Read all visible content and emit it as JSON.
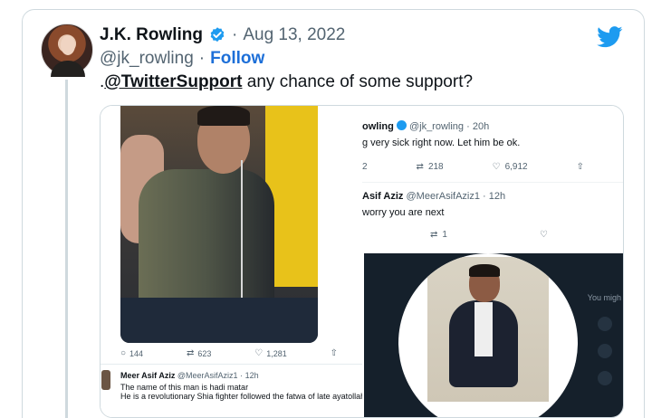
{
  "tweet": {
    "name": "J.K. Rowling",
    "date_separator": "·",
    "date": "Aug 13, 2022",
    "handle": "@jk_rowling",
    "handle_separator": "·",
    "follow_label": "Follow",
    "text_prefix": ".",
    "mention": "@TwitterSupport",
    "text_rest": " any chance of some support?"
  },
  "icons": {
    "verified": "verified-badge-icon",
    "brand": "twitter-bird-icon",
    "reply": "reply-icon",
    "retweet": "retweet-icon",
    "like": "like-icon",
    "share": "share-icon"
  },
  "colors": {
    "accent": "#1d9bf0",
    "follow": "#1d6fd8",
    "muted": "#536471",
    "dark_panel": "#15202b"
  },
  "left_shot": {
    "actions": {
      "replies": "144",
      "retweets": "623",
      "likes": "1,281"
    },
    "reply": {
      "name": "Meer Asif Aziz",
      "handle": "@MeerAsifAziz1",
      "sep": "·",
      "time": "12h",
      "line1": "The name of this man is hadi matar",
      "line2": "He is a revolutionary Shia fighter followed the fatwa of late ayatollah"
    }
  },
  "right_shot": {
    "header_name": "owling",
    "header_handle": "@jk_rowling",
    "header_sep": "·",
    "header_time": "20h",
    "header_text": "g very sick right now. Let him be ok.",
    "actions": {
      "replies": "2",
      "retweets": "218",
      "likes": "6,912"
    },
    "reply_name": "Asif Aziz",
    "reply_handle": "@MeerAsifAziz1",
    "reply_sep": "·",
    "reply_time": "12h",
    "reply_text": "worry you are next",
    "reply_retweets": "1",
    "side_text": "You migh"
  }
}
